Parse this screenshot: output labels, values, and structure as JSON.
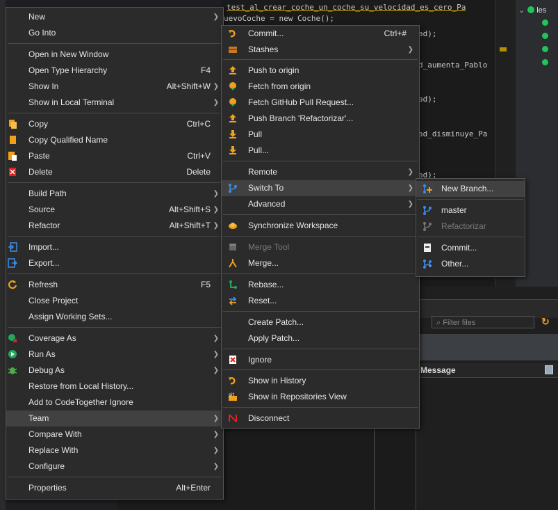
{
  "editor": {
    "line1": "test_al_crear_coche_un_coche_su_velocidad_es_cero_Pa",
    "line2": "uevoCoche = new Coche();",
    "frag1": "ad);",
    "frag2": "d_aumenta_Pablo",
    "frag3": "ad);",
    "frag4": "ad_disminuye_Pa",
    "frag5": "ad);"
  },
  "tree": {
    "label": "les"
  },
  "history": {
    "filter_placeholder": "Filter files",
    "message_header": "Message"
  },
  "colors": {
    "menu_bg": "#2b2b2b",
    "highlight": "#414141",
    "separator": "#4a4a4a",
    "accent_orange": "#f0a01c",
    "accent_green": "#21c45a",
    "accent_blue": "#3c8ce7"
  },
  "context_menu": {
    "items": [
      {
        "label": "New",
        "submenu": true
      },
      {
        "label": "Go Into"
      },
      {
        "label": "Open in New Window"
      },
      {
        "label": "Open Type Hierarchy",
        "shortcut": "F4"
      },
      {
        "label": "Show In",
        "shortcut": "Alt+Shift+W",
        "submenu": true
      },
      {
        "label": "Show in Local Terminal",
        "submenu": true
      },
      {
        "label": "Copy",
        "shortcut": "Ctrl+C",
        "icon": "copy-icon"
      },
      {
        "label": "Copy Qualified Name",
        "icon": "copy-qualified-icon"
      },
      {
        "label": "Paste",
        "shortcut": "Ctrl+V",
        "icon": "paste-icon"
      },
      {
        "label": "Delete",
        "shortcut": "Delete",
        "icon": "delete-icon"
      },
      {
        "label": "Build Path",
        "submenu": true
      },
      {
        "label": "Source",
        "shortcut": "Alt+Shift+S",
        "submenu": true
      },
      {
        "label": "Refactor",
        "shortcut": "Alt+Shift+T",
        "submenu": true
      },
      {
        "label": "Import...",
        "icon": "import-icon"
      },
      {
        "label": "Export...",
        "icon": "export-icon"
      },
      {
        "label": "Refresh",
        "shortcut": "F5",
        "icon": "refresh-icon"
      },
      {
        "label": "Close Project"
      },
      {
        "label": "Assign Working Sets..."
      },
      {
        "label": "Coverage As",
        "submenu": true,
        "icon": "coverage-icon"
      },
      {
        "label": "Run As",
        "submenu": true,
        "icon": "run-icon"
      },
      {
        "label": "Debug As",
        "submenu": true,
        "icon": "debug-icon"
      },
      {
        "label": "Restore from Local History..."
      },
      {
        "label": "Add to CodeTogether Ignore"
      },
      {
        "label": "Team",
        "submenu": true,
        "highlighted": true
      },
      {
        "label": "Compare With",
        "submenu": true
      },
      {
        "label": "Replace With",
        "submenu": true
      },
      {
        "label": "Configure",
        "submenu": true
      },
      {
        "label": "Properties",
        "shortcut": "Alt+Enter"
      }
    ]
  },
  "team_menu": {
    "items": [
      {
        "label": "Commit...",
        "shortcut": "Ctrl+#",
        "icon": "commit-icon"
      },
      {
        "label": "Stashes",
        "submenu": true,
        "icon": "stashes-icon"
      },
      {
        "label": "Push to origin",
        "icon": "push-icon"
      },
      {
        "label": "Fetch from origin",
        "icon": "fetch-icon"
      },
      {
        "label": "Fetch GitHub Pull Request...",
        "icon": "fetch-pr-icon"
      },
      {
        "label": "Push Branch 'Refactorizar'...",
        "icon": "push-branch-icon"
      },
      {
        "label": "Pull",
        "icon": "pull-icon"
      },
      {
        "label": "Pull...",
        "icon": "pull-dialog-icon"
      },
      {
        "label": "Remote",
        "submenu": true
      },
      {
        "label": "Switch To",
        "submenu": true,
        "highlighted": true,
        "icon": "switch-icon"
      },
      {
        "label": "Advanced",
        "submenu": true
      },
      {
        "label": "Synchronize Workspace",
        "icon": "synchronize-icon"
      },
      {
        "label": "Merge Tool",
        "disabled": true,
        "icon": "merge-tool-icon"
      },
      {
        "label": "Merge...",
        "icon": "merge-icon"
      },
      {
        "label": "Rebase...",
        "icon": "rebase-icon"
      },
      {
        "label": "Reset...",
        "icon": "reset-icon"
      },
      {
        "label": "Create Patch..."
      },
      {
        "label": "Apply Patch..."
      },
      {
        "label": "Ignore",
        "icon": "ignore-icon"
      },
      {
        "label": "Show in History",
        "icon": "history-icon"
      },
      {
        "label": "Show in Repositories View",
        "icon": "repositories-icon"
      },
      {
        "label": "Disconnect",
        "icon": "disconnect-icon"
      }
    ]
  },
  "switch_menu": {
    "items": [
      {
        "label": "New Branch...",
        "highlighted": true,
        "icon": "new-branch-icon"
      },
      {
        "label": "master",
        "icon": "branch-icon"
      },
      {
        "label": "Refactorizar",
        "disabled": true,
        "icon": "branch-disabled-icon"
      },
      {
        "label": "Commit...",
        "icon": "commit-file-icon"
      },
      {
        "label": "Other...",
        "icon": "other-branches-icon"
      }
    ]
  }
}
